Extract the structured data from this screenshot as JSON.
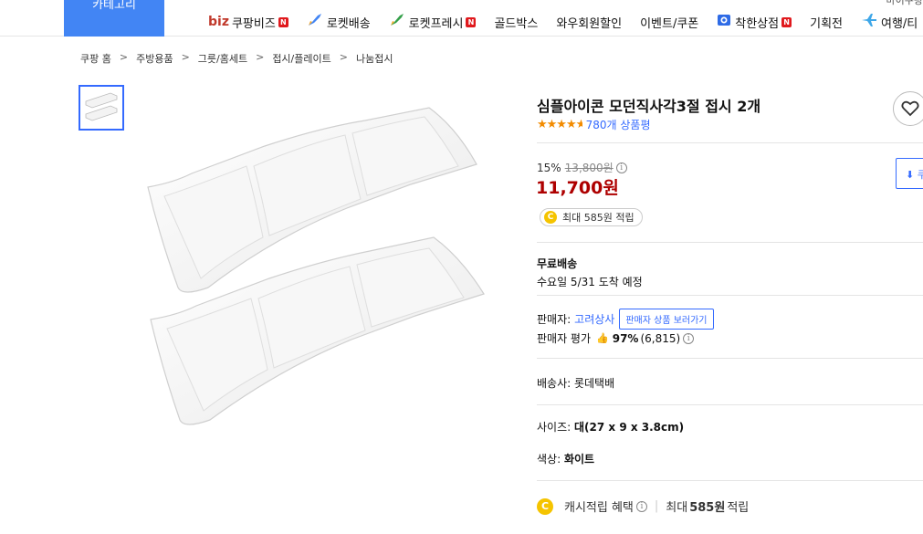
{
  "topnav": {
    "category": "카테고리",
    "top_right": "마이쿠팡",
    "items": [
      {
        "prefix": "biz",
        "label": "쿠팡비즈",
        "badge": "N"
      },
      {
        "label": "로켓배송"
      },
      {
        "label": "로켓프레시",
        "badge": "N"
      },
      {
        "label": "골드박스"
      },
      {
        "label": "와우회원할인"
      },
      {
        "label": "이벤트/쿠폰"
      },
      {
        "label": "착한상점",
        "badge": "N"
      },
      {
        "label": "기획전"
      },
      {
        "label": "여행/티"
      }
    ]
  },
  "breadcrumb": [
    "쿠팡 홈",
    "주방용품",
    "그릇/홈세트",
    "접시/플레이트",
    "나눔접시"
  ],
  "product": {
    "title": "심플아이콘 모던직사각3절 접시 2개",
    "review_count": "780개 상품평",
    "rating": 4.5,
    "discount_rate": "15%",
    "original_price": "13,800원",
    "price": "11,700원",
    "reward": "최대 585원 적립",
    "coupon_label": "쿠",
    "shipping_label": "무료배송",
    "shipping_date": "수요일 5/31 도착 예정",
    "seller_label": "판매자:",
    "seller_name": "고려상사",
    "seller_button": "판매자 상품 보러가기",
    "seller_rating_label": "판매자 평가",
    "seller_rating_pct": "97%",
    "seller_rating_count": "(6,815)",
    "shipper": "배송사: 롯데택배",
    "size_label": "사이즈:",
    "size_value": "대(27 x 9 x 3.8cm)",
    "color_label": "색상:",
    "color_value": "화이트",
    "cash_benefit_label": "캐시적립 혜택",
    "cash_benefit_prefix": "최대",
    "cash_benefit_amount": "585원",
    "cash_benefit_suffix": "적립"
  },
  "colors": {
    "accent": "#4285f4",
    "link": "#346aff",
    "price": "#ae0000",
    "star": "#f28b00",
    "coin": "#f5c400"
  }
}
